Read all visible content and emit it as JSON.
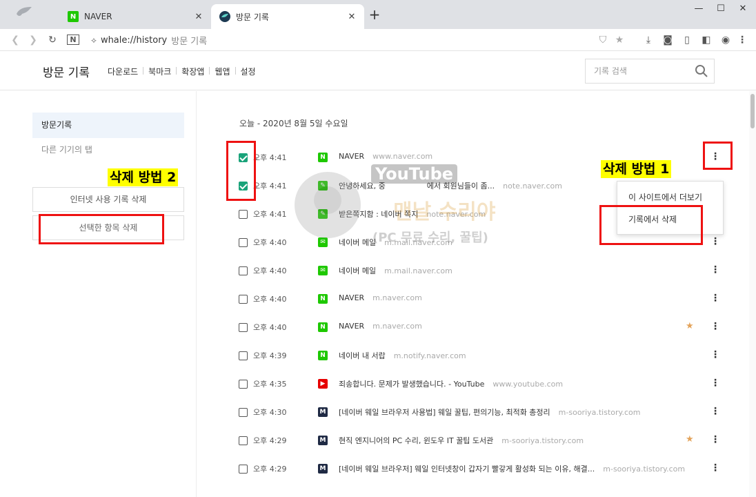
{
  "tabs": [
    {
      "title": "NAVER"
    },
    {
      "title": "방문 기록"
    }
  ],
  "address_bar": {
    "url": "whale://history",
    "page_title": "방문 기록"
  },
  "header": {
    "title": "방문 기록",
    "nav": [
      "다운로드",
      "북마크",
      "확장앱",
      "웹앱",
      "설정"
    ],
    "search_placeholder": "기록 검색"
  },
  "sidebar": {
    "items": [
      "방문기록",
      "다른 기기의 탭"
    ],
    "buttons": [
      "인터넷 사용 기록 삭제",
      "선택한 항목 삭제"
    ]
  },
  "date_heading": "오늘 - 2020년 8월 5일 수요일",
  "rows": [
    {
      "checked": true,
      "time": "오후 4:41",
      "icon": "naver",
      "title": "NAVER",
      "url": "www.naver.com",
      "starred": false
    },
    {
      "checked": true,
      "time": "오후 4:41",
      "icon": "note",
      "title": "안녕하세요, 중",
      "title_tail": "에서 회원님들이 좀...",
      "url": "note.naver.com",
      "starred": false
    },
    {
      "checked": false,
      "time": "오후 4:41",
      "icon": "note",
      "title": "받은쪽지함 : 네이버 쪽지",
      "url": "note.naver.com",
      "starred": false
    },
    {
      "checked": false,
      "time": "오후 4:40",
      "icon": "mail",
      "title": "네이버 메일",
      "url": "m.mail.naver.com",
      "starred": false
    },
    {
      "checked": false,
      "time": "오후 4:40",
      "icon": "mail",
      "title": "네이버 메일",
      "url": "m.mail.naver.com",
      "starred": false
    },
    {
      "checked": false,
      "time": "오후 4:40",
      "icon": "naver",
      "title": "NAVER",
      "url": "m.naver.com",
      "starred": false
    },
    {
      "checked": false,
      "time": "오후 4:40",
      "icon": "naver",
      "title": "NAVER",
      "url": "m.naver.com",
      "starred": true
    },
    {
      "checked": false,
      "time": "오후 4:39",
      "icon": "naver",
      "title": "네이버 내 서랍",
      "url": "m.notify.naver.com",
      "starred": false
    },
    {
      "checked": false,
      "time": "오후 4:35",
      "icon": "youtube",
      "title": "죄송합니다. 문제가 발생했습니다. - YouTube",
      "url": "www.youtube.com",
      "starred": false
    },
    {
      "checked": false,
      "time": "오후 4:30",
      "icon": "tistory",
      "title": "[네이버 웨일 브라우저 사용법] 웨일 꿀팁, 편의기능, 최적화 총정리",
      "url": "m-sooriya.tistory.com",
      "starred": false
    },
    {
      "checked": false,
      "time": "오후 4:29",
      "icon": "tistory",
      "title": "현직 엔지니어의 PC 수리, 윈도우 IT 꿀팁 도서관",
      "url": "m-sooriya.tistory.com",
      "starred": true
    },
    {
      "checked": false,
      "time": "오후 4:29",
      "icon": "tistory",
      "title": "[네이버 웨일 브라우저] 웨일 인터넷창이 갑자기 빨갛게 활성화 되는 이유, 해결...",
      "url": "m-sooriya.tistory.com",
      "starred": false
    }
  ],
  "context_menu": [
    "이 사이트에서 더보기",
    "기록에서 삭제"
  ],
  "annotations": {
    "method1": "삭제 방법 1",
    "method2": "삭제 방법 2"
  },
  "watermark": {
    "line1": "YouTube",
    "line2": "맨날 수리야",
    "line3": "(PC 무료 수리, 꿀팁)"
  },
  "colors": {
    "checkbox": "#1aa37a",
    "star": "#e3a35a",
    "annotation_box": "#ee1111",
    "annotation_fill": "#ffff00"
  }
}
